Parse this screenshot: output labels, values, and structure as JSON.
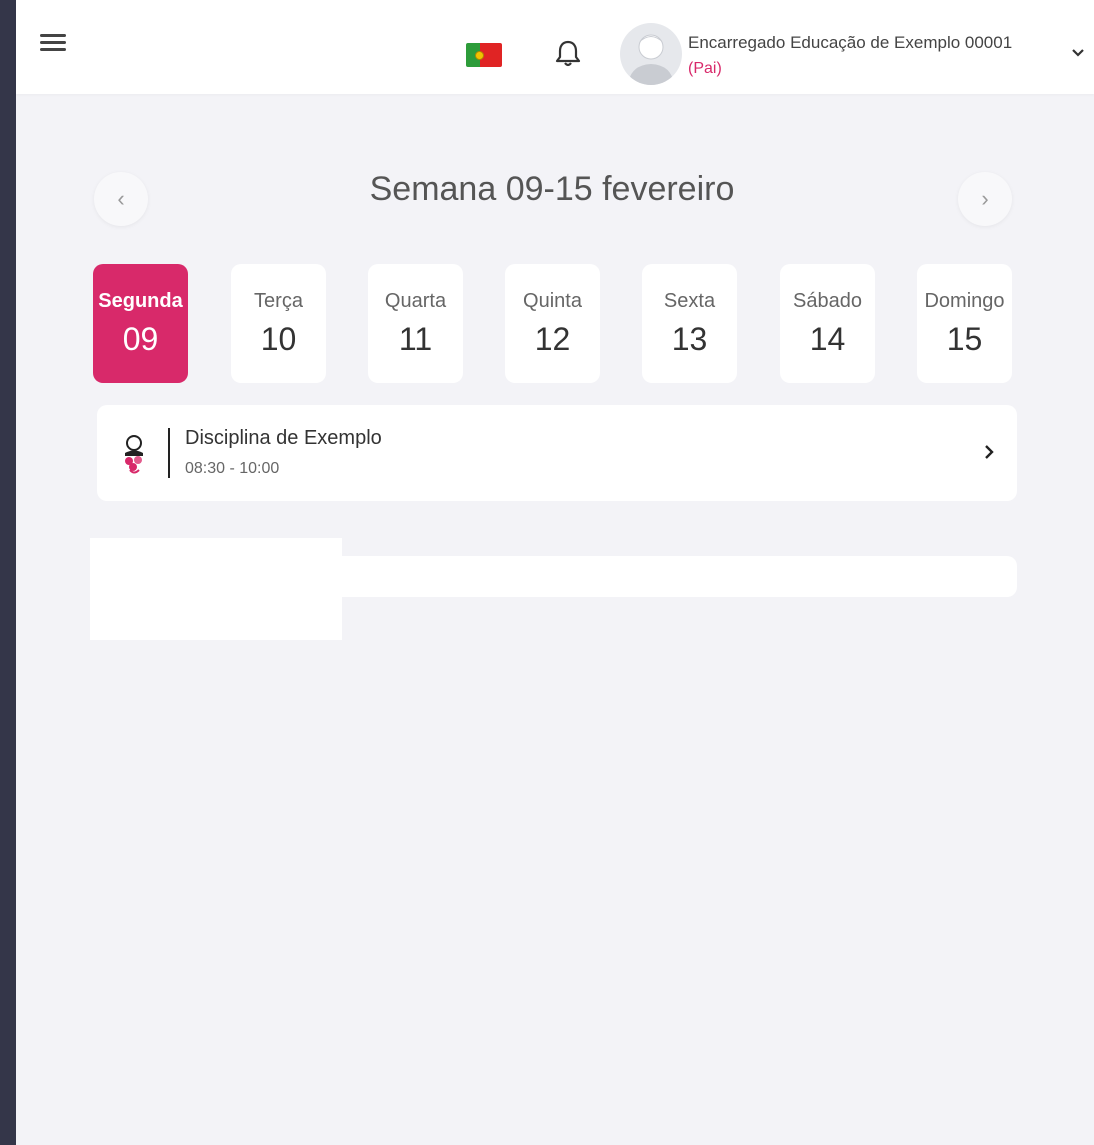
{
  "header": {
    "user_name": "Encarregado Educação de Exemplo 00001",
    "user_role": "(Pai)",
    "icons": {
      "menu": "hamburger-icon",
      "flag": "portugal-flag-icon",
      "notifications": "bell-icon",
      "avatar": "user-avatar-icon",
      "dropdown": "chevron-down-icon"
    }
  },
  "week": {
    "title": "Semana 09-15 fevereiro",
    "prev_label": "‹",
    "next_label": "›"
  },
  "days": [
    {
      "name": "Segunda",
      "date": "09",
      "active": true
    },
    {
      "name": "Terça",
      "date": "10"
    },
    {
      "name": "Quarta",
      "date": "11"
    },
    {
      "name": "Quinta",
      "date": "12"
    },
    {
      "name": "Sexta",
      "date": "13"
    },
    {
      "name": "Sábado",
      "date": "14"
    },
    {
      "name": "Domingo",
      "date": "15"
    }
  ],
  "lessons": [
    {
      "title": "Disciplina de Exemplo",
      "time": "08:30 - 10:00",
      "icon": "teacher-icon"
    }
  ],
  "colors": {
    "accent": "#d8296a",
    "sidebar": "#343649",
    "background": "#f3f3f7"
  }
}
